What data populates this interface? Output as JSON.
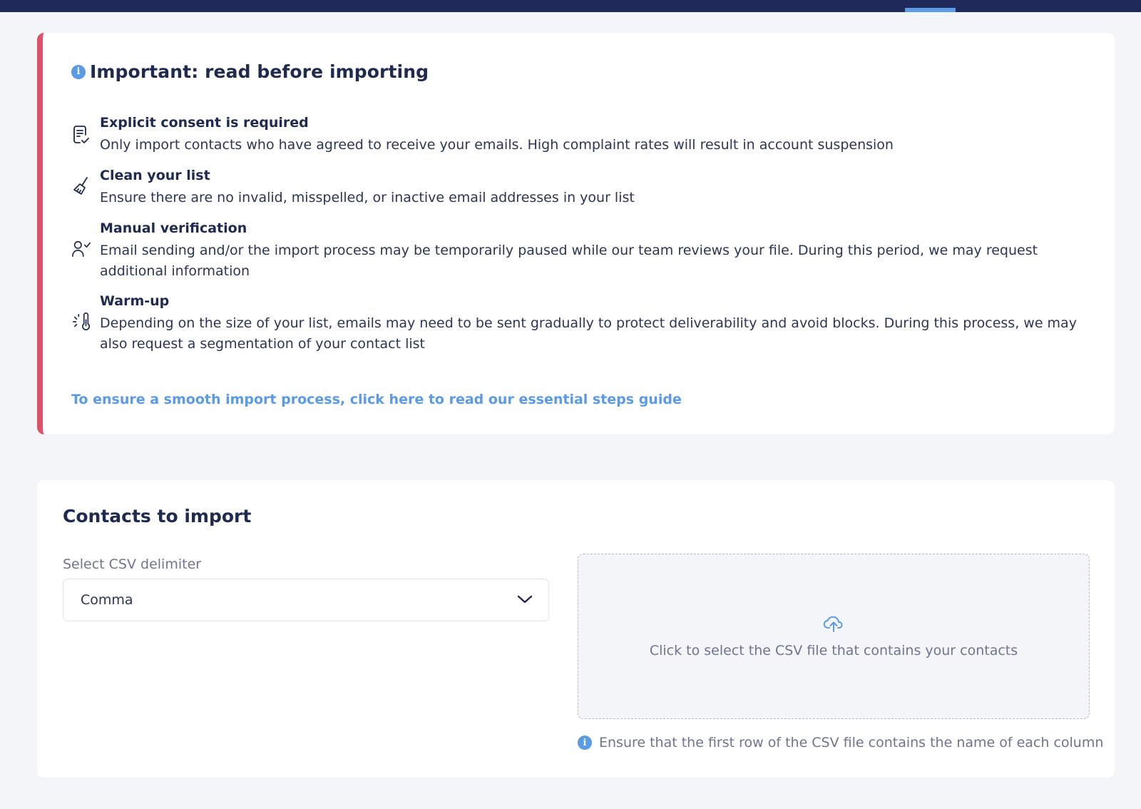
{
  "notice": {
    "title": "Important: read before importing",
    "items": [
      {
        "icon": "checklist-icon",
        "heading": "Explicit consent is required",
        "description": "Only import contacts who have agreed to receive your emails. High complaint rates will result in account suspension"
      },
      {
        "icon": "broom-icon",
        "heading": "Clean your list",
        "description": "Ensure there are no invalid, misspelled, or inactive email addresses in your list"
      },
      {
        "icon": "user-check-icon",
        "heading": "Manual verification",
        "description": "Email sending and/or the import process may be temporarily paused while our team reviews your file. During this period, we may request additional information"
      },
      {
        "icon": "thermometer-icon",
        "heading": "Warm-up",
        "description": "Depending on the size of your list, emails may need to be sent gradually to protect deliverability and avoid blocks. During this process, we may also request a segmentation of your contact list"
      }
    ],
    "guide_link": "To ensure a smooth import process, click here to read our essential steps guide"
  },
  "import": {
    "title": "Contacts to import",
    "delimiter_label": "Select CSV delimiter",
    "delimiter_value": "Comma",
    "dropzone_text": "Click to select the CSV file that contains your contacts",
    "hint": "Ensure that the first row of the CSV file contains the name of each column"
  },
  "colors": {
    "navy": "#1f2a5a",
    "accent_blue": "#5b9be6",
    "alert_red": "#e0506a"
  }
}
